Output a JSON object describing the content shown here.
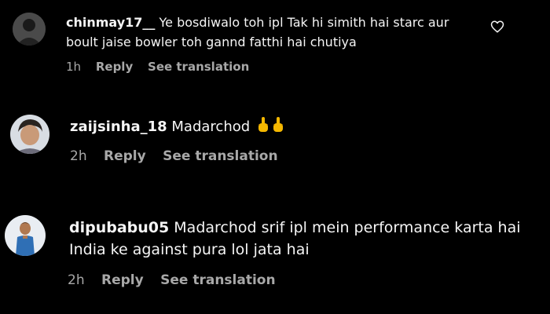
{
  "comments": [
    {
      "username": "chinmay17__",
      "text_line1": "Ye bosdiwalo toh ipl Tak hi simith hai starc aur",
      "text_line2": "boult jaise bowler toh gannd fatthi hai chutiya",
      "time": "1h",
      "reply": "Reply",
      "translate": "See translation",
      "like_icon": "heart-outline-icon"
    },
    {
      "username": "zaijsinha_18",
      "text_line1": "Madarchod",
      "emoji": "middle-finger-emoji",
      "time": "2h",
      "reply": "Reply",
      "translate": "See translation"
    },
    {
      "username": "dipubabu05",
      "text_line1": "Madarchod srif ipl mein performance karta hai",
      "text_line2": "India ke against pura lol jata hai",
      "time": "2h",
      "reply": "Reply",
      "translate": "See translation"
    }
  ],
  "colors": {
    "background": "#000000",
    "text": "#f5f5f5",
    "muted": "#a8a8a8",
    "emoji": "#f5b800"
  }
}
